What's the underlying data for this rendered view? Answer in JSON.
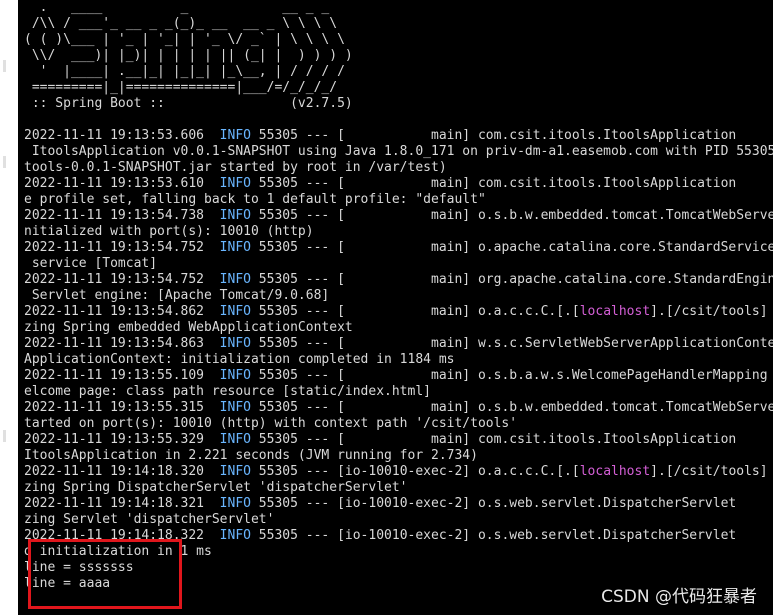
{
  "terminal": {
    "banner": [
      "  .   ____          _            __ _ _",
      " /\\\\ / ___'_ __ _ _(_)_ __  __ _ \\ \\ \\ \\",
      "( ( )\\___ | '_ | '_| | '_ \\/ _` | \\ \\ \\ \\",
      " \\\\/  ___)| |_)| | | | | || (_| |  ) ) ) )",
      "  '  |____| .__|_| |_|_| |_\\__, | / / / /",
      " =========|_|==============|___/=/_/_/_/",
      " :: Spring Boot ::                (v2.7.5)"
    ],
    "log_lines": [
      {
        "pre": "2022-11-11 19:13:53.606  ",
        "level": "INFO",
        "mid": " 55305 --- [           main] com.csit.itools.ItoolsApplication"
      },
      {
        "text": " ItoolsApplication v0.0.1-SNAPSHOT using Java 1.8.0_171 on priv-dm-a1.easemob.com with PID 55305"
      },
      {
        "text": "tools-0.0.1-SNAPSHOT.jar started by root in /var/test)"
      },
      {
        "pre": "2022-11-11 19:13:53.610  ",
        "level": "INFO",
        "mid": " 55305 --- [           main] com.csit.itools.ItoolsApplication"
      },
      {
        "text": "e profile set, falling back to 1 default profile: \"default\""
      },
      {
        "pre": "2022-11-11 19:13:54.738  ",
        "level": "INFO",
        "mid": " 55305 --- [           main] o.s.b.w.embedded.tomcat.TomcatWebServer"
      },
      {
        "text": "nitialized with port(s): 10010 (http)"
      },
      {
        "pre": "2022-11-11 19:13:54.752  ",
        "level": "INFO",
        "mid": " 55305 --- [           main] o.apache.catalina.core.StandardService"
      },
      {
        "text": " service [Tomcat]"
      },
      {
        "pre": "2022-11-11 19:13:54.752  ",
        "level": "INFO",
        "mid": " 55305 --- [           main] org.apache.catalina.core.StandardEngine"
      },
      {
        "text": " Servlet engine: [Apache Tomcat/9.0.68]"
      },
      {
        "pre": "2022-11-11 19:13:54.862  ",
        "level": "INFO",
        "mid": " 55305 --- [           main] o.a.c.c.C.[.[",
        "host": "localhost",
        "post": "].[/csit/tools]"
      },
      {
        "text": "zing Spring embedded WebApplicationContext"
      },
      {
        "pre": "2022-11-11 19:13:54.863  ",
        "level": "INFO",
        "mid": " 55305 --- [           main] w.s.c.ServletWebServerApplicationContext"
      },
      {
        "text": "ApplicationContext: initialization completed in 1184 ms"
      },
      {
        "pre": "2022-11-11 19:13:55.109  ",
        "level": "INFO",
        "mid": " 55305 --- [           main] o.s.b.a.w.s.WelcomePageHandlerMapping"
      },
      {
        "text": "elcome page: class path resource [static/index.html]"
      },
      {
        "pre": "2022-11-11 19:13:55.315  ",
        "level": "INFO",
        "mid": " 55305 --- [           main] o.s.b.w.embedded.tomcat.TomcatWebServer"
      },
      {
        "text": "tarted on port(s): 10010 (http) with context path '/csit/tools'"
      },
      {
        "pre": "2022-11-11 19:13:55.329  ",
        "level": "INFO",
        "mid": " 55305 --- [           main] com.csit.itools.ItoolsApplication"
      },
      {
        "text": "ItoolsApplication in 2.221 seconds (JVM running for 2.734)"
      },
      {
        "pre": "2022-11-11 19:14:18.320  ",
        "level": "INFO",
        "mid": " 55305 --- [io-10010-exec-2] o.a.c.c.C.[.[",
        "host": "localhost",
        "post": "].[/csit/tools]"
      },
      {
        "text": "zing Spring DispatcherServlet 'dispatcherServlet'"
      },
      {
        "pre": "2022-11-11 19:14:18.321  ",
        "level": "INFO",
        "mid": " 55305 --- [io-10010-exec-2] o.s.web.servlet.DispatcherServlet"
      },
      {
        "text": "zing Servlet 'dispatcherServlet'"
      },
      {
        "pre": "2022-11-11 19:14:18.322  ",
        "level": "INFO",
        "mid": " 55305 --- [io-10010-exec-2] o.s.web.servlet.DispatcherServlet"
      },
      {
        "text": "d initialization in 1 ms"
      },
      {
        "text": "line = sssssss"
      },
      {
        "text": "line = aaaa"
      }
    ],
    "colors": {
      "background": "#000000",
      "text": "#d9d9d9",
      "info": "#6ab6ff",
      "localhost": "#d45fd6",
      "highlight_border": "#e0161c"
    }
  },
  "watermark": "CSDN @代码狂暴者"
}
